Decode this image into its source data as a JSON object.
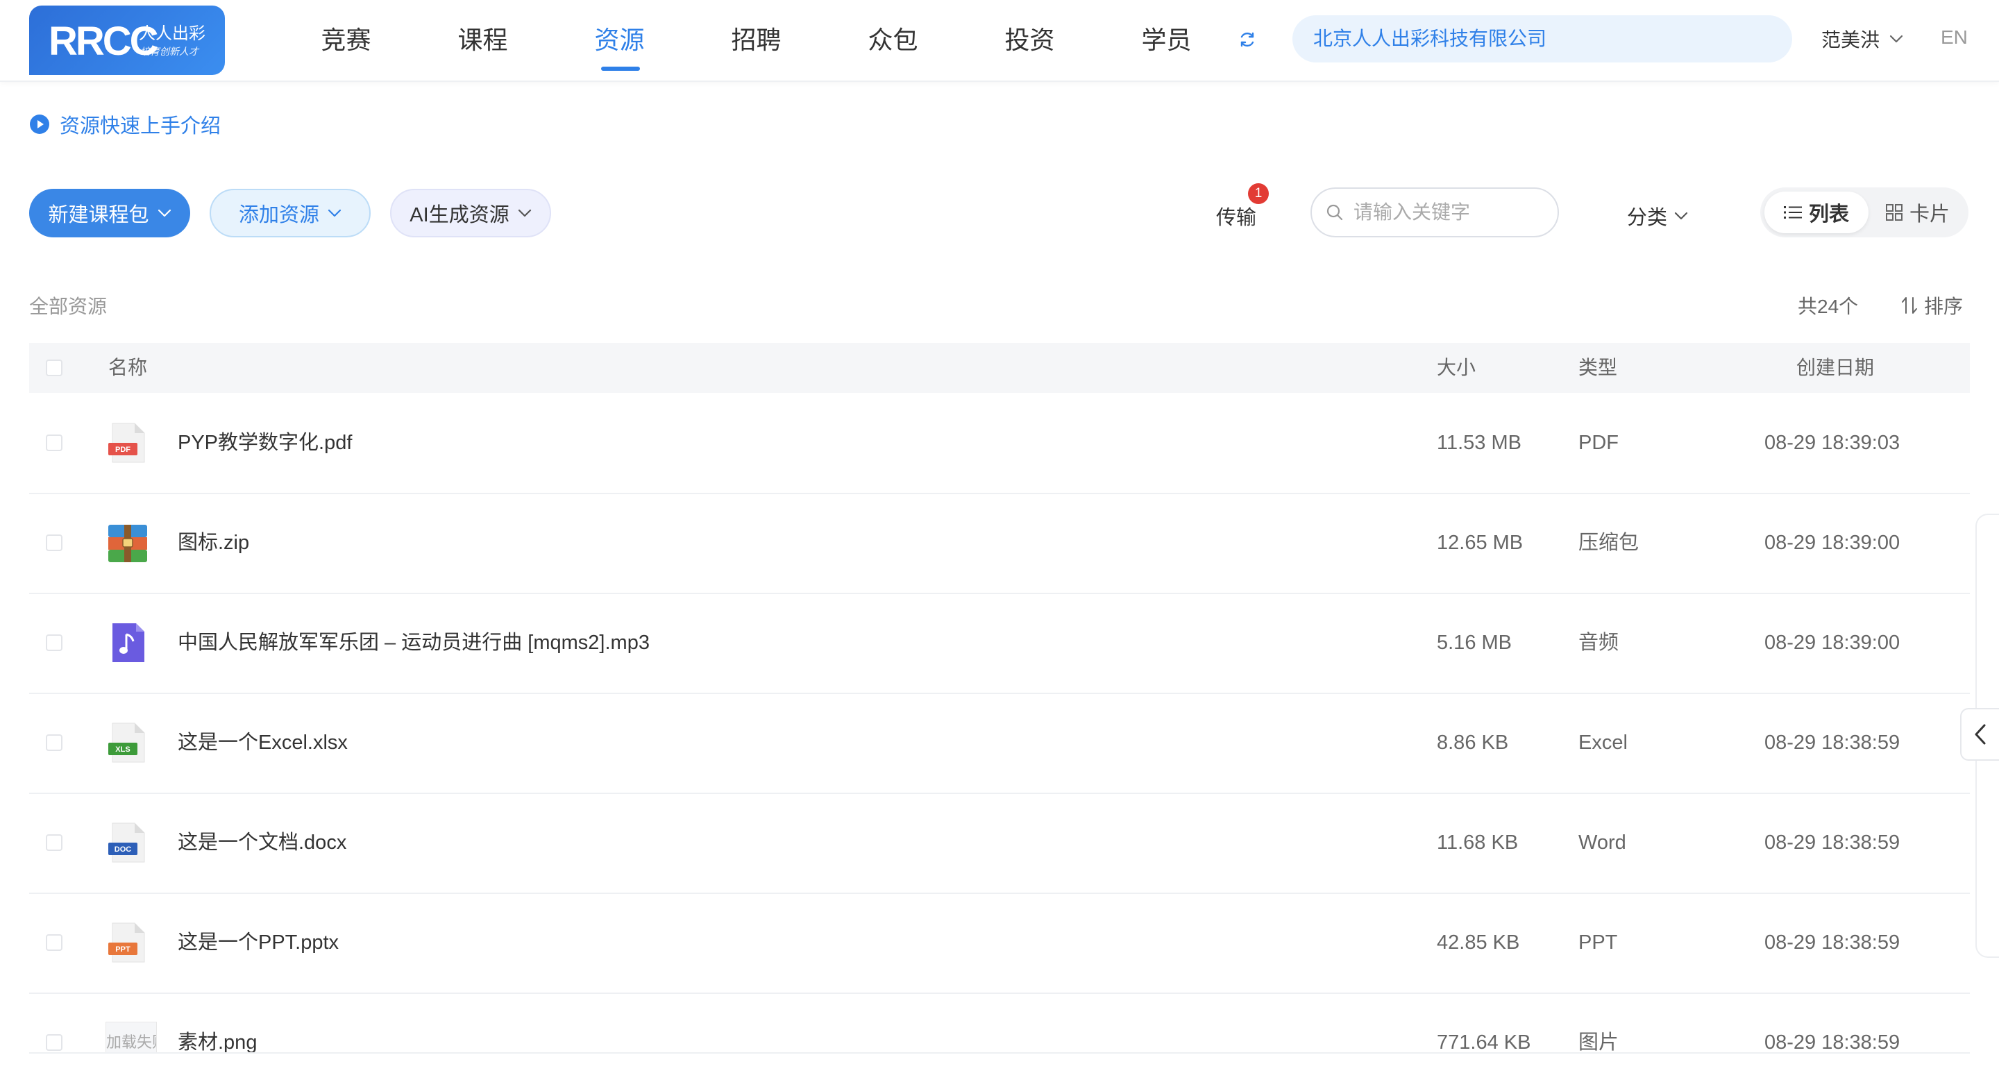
{
  "header": {
    "logo": {
      "mark": "RRCC",
      "cn": "人人出彩",
      "slogan": "培育创新人才"
    },
    "nav": [
      {
        "label": "竞赛",
        "active": false
      },
      {
        "label": "课程",
        "active": false
      },
      {
        "label": "资源",
        "active": true
      },
      {
        "label": "招聘",
        "active": false
      },
      {
        "label": "众包",
        "active": false
      },
      {
        "label": "投资",
        "active": false
      },
      {
        "label": "学员",
        "active": false
      }
    ],
    "company": "北京人人出彩科技有限公司",
    "user": "范美洪",
    "lang": "EN"
  },
  "intro": {
    "label": "资源快速上手介绍"
  },
  "toolbar": {
    "new_package": "新建课程包",
    "add_resource": "添加资源",
    "ai_generate": "AI生成资源",
    "transfer": "传输",
    "transfer_badge": "1",
    "search_placeholder": "请输入关键字",
    "category": "分类",
    "view_list": "列表",
    "view_card": "卡片"
  },
  "summary": {
    "title": "全部资源",
    "count": "共24个",
    "sort": "排序"
  },
  "table": {
    "headers": {
      "name": "名称",
      "size": "大小",
      "type": "类型",
      "date": "创建日期"
    },
    "rows": [
      {
        "icon": "pdf-file-icon",
        "name": "PYP教学数字化.pdf",
        "size": "11.53 MB",
        "type": "PDF",
        "date": "08-29 18:39:03"
      },
      {
        "icon": "zip-archive-icon",
        "name": "图标.zip",
        "size": "12.65 MB",
        "type": "压缩包",
        "date": "08-29 18:39:00"
      },
      {
        "icon": "audio-file-icon",
        "name": "中国人民解放军军乐团 – 运动员进行曲 [mqms2].mp3",
        "size": "5.16 MB",
        "type": "音频",
        "date": "08-29 18:39:00"
      },
      {
        "icon": "excel-file-icon",
        "name": "这是一个Excel.xlsx",
        "size": "8.86 KB",
        "type": "Excel",
        "date": "08-29 18:38:59"
      },
      {
        "icon": "word-file-icon",
        "name": "这是一个文档.docx",
        "size": "11.68 KB",
        "type": "Word",
        "date": "08-29 18:38:59"
      },
      {
        "icon": "ppt-file-icon",
        "name": "这是一个PPT.pptx",
        "size": "42.85 KB",
        "type": "PPT",
        "date": "08-29 18:38:59"
      },
      {
        "icon": "broken-image-icon",
        "name": "素材.png",
        "size": "771.64 KB",
        "type": "图片",
        "date": "08-29 18:38:59",
        "thumb_text": "加载失败"
      }
    ]
  },
  "icon_labels": {
    "pdf": "PDF",
    "xls": "XLS",
    "doc": "DOC",
    "ppt": "PPT"
  },
  "colors": {
    "accent": "#2f80e8",
    "primary_button": "#3a87e6",
    "badge": "#e23b34",
    "pdf": "#e5524a",
    "xls": "#3d9b3a",
    "doc": "#2d5fb8",
    "ppt": "#e8773b",
    "audio": "#6a5be0"
  }
}
